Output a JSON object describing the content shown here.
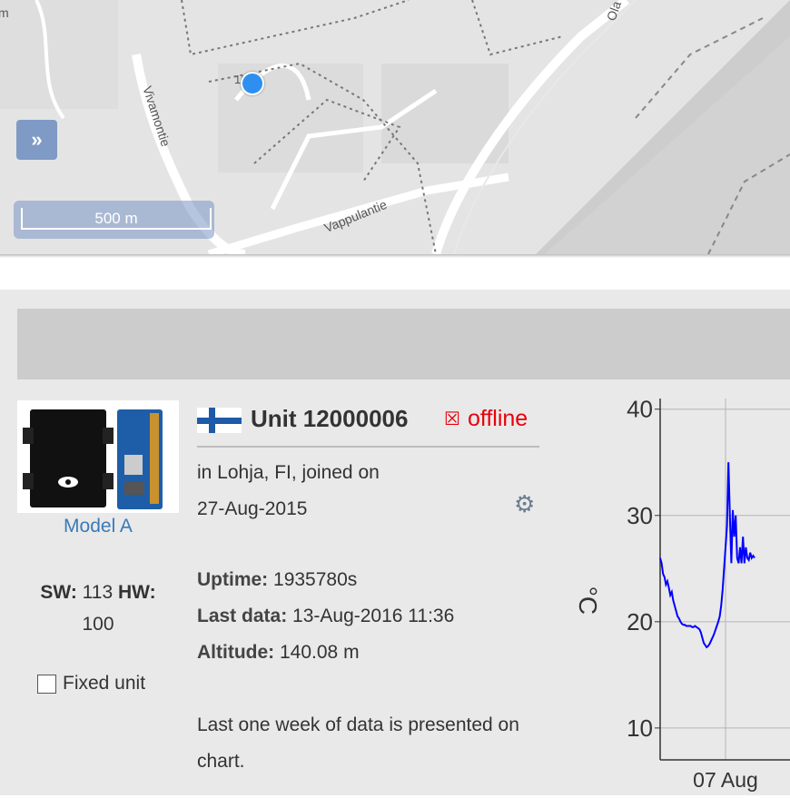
{
  "map": {
    "labels": {
      "street_1": "Vivamontie",
      "street_2": "Vappulantie",
      "street_3": "Ola"
    },
    "marker_label": "1005",
    "scale": "500 m",
    "expand_icon": "»",
    "colors": {
      "road": "#ffffff",
      "marker": "#2f8ff0",
      "forest": "#cfcfcf",
      "control": "#7f9ac4"
    }
  },
  "device": {
    "model": "Model A",
    "sw_label": "SW:",
    "sw_value": "113",
    "hw_label": "HW:",
    "hw_value": "100",
    "fixed_unit_label": "Fixed unit",
    "fixed_unit_checked": false
  },
  "unit": {
    "flag": "finland-flag",
    "title": "Unit 12000006",
    "status_icon": "☒",
    "status": "offline",
    "location_line": "in Lohja, FI, joined on",
    "joined": "27-Aug-2015",
    "uptime_label": "Uptime:",
    "uptime_value": "1935780s",
    "last_data_label": "Last data:",
    "last_data_value": "13-Aug-2016 11:36",
    "altitude_label": "Altitude:",
    "altitude_value": "140.08 m",
    "note": "Last one week of data is presented on chart.",
    "colors": {
      "offline": "#e8000b",
      "link": "#3a7ab8"
    }
  },
  "chart_data": {
    "type": "line",
    "ylabel": "°C",
    "yticks": [
      10,
      20,
      30,
      40
    ],
    "ylim": [
      7,
      41
    ],
    "xtick_labels": [
      "07 Aug"
    ],
    "xlim": [
      0,
      100
    ],
    "xticks": [
      45
    ],
    "series": [
      {
        "color": "#0000ff",
        "x": [
          0,
          1,
          2,
          3,
          4,
          5,
          6,
          7,
          8,
          9,
          10,
          11,
          12,
          13,
          14,
          15,
          16,
          17,
          18,
          19,
          20,
          21,
          22,
          23,
          24,
          25,
          26,
          27,
          28,
          29,
          30,
          31,
          32,
          33,
          34,
          35,
          36,
          37,
          38,
          39,
          40,
          41,
          42,
          43,
          44,
          45,
          46,
          47,
          48,
          49,
          50,
          51,
          52,
          53,
          54,
          55,
          56,
          57,
          58,
          59,
          60,
          61,
          62,
          63,
          64,
          65
        ],
        "y": [
          26,
          25.5,
          24.5,
          24.2,
          23.5,
          23.8,
          23.2,
          22.5,
          22.8,
          22,
          21.5,
          21,
          20.5,
          20.3,
          20,
          19.8,
          19.7,
          19.7,
          19.6,
          19.6,
          19.6,
          19.6,
          19.5,
          19.5,
          19.6,
          19.5,
          19.4,
          19.3,
          19,
          18.5,
          18,
          17.8,
          17.6,
          17.7,
          17.9,
          18.2,
          18.5,
          18.8,
          19.2,
          19.6,
          20,
          20.5,
          21.5,
          23,
          25,
          27,
          29,
          35,
          30,
          25.5,
          30.5,
          28,
          30,
          26,
          25.5,
          27,
          25.5,
          28,
          25.5,
          27,
          26,
          25.8,
          26.5,
          26,
          26.2,
          26
        ]
      }
    ]
  }
}
